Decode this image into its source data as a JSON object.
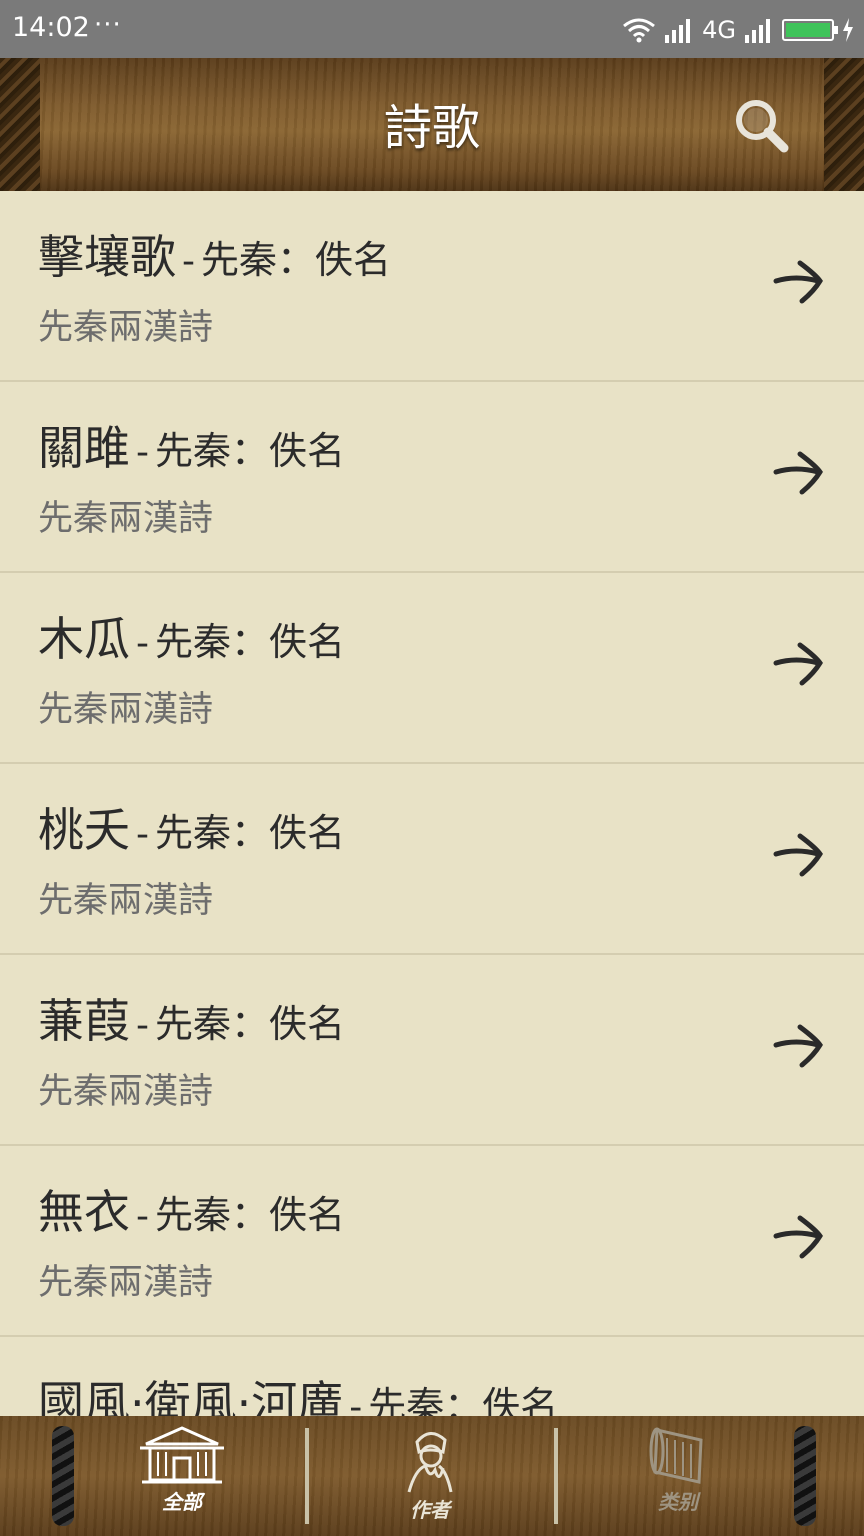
{
  "status_bar": {
    "time": "14:02",
    "dots": "···",
    "network": "4G"
  },
  "header": {
    "title": "詩歌"
  },
  "list": {
    "items": [
      {
        "title": "擊壤歌",
        "separator": "-",
        "author": "先秦：佚名",
        "category": "先秦兩漢詩"
      },
      {
        "title": "關雎",
        "separator": "-",
        "author": "先秦：佚名",
        "category": "先秦兩漢詩"
      },
      {
        "title": "木瓜",
        "separator": "-",
        "author": "先秦：佚名",
        "category": "先秦兩漢詩"
      },
      {
        "title": "桃夭",
        "separator": "-",
        "author": "先秦：佚名",
        "category": "先秦兩漢詩"
      },
      {
        "title": "蒹葭",
        "separator": "-",
        "author": "先秦：佚名",
        "category": "先秦兩漢詩"
      },
      {
        "title": "無衣",
        "separator": "-",
        "author": "先秦：佚名",
        "category": "先秦兩漢詩"
      },
      {
        "title": "國風·衛風·河廣",
        "separator": "-",
        "author": "先秦：佚名",
        "category": ""
      }
    ]
  },
  "tabs": [
    {
      "label": "全部",
      "icon": "house-icon",
      "active": true,
      "color": "#ffffff"
    },
    {
      "label": "作者",
      "icon": "poet-portrait-icon",
      "active": false,
      "color": "#e9e4d6"
    },
    {
      "label": "类别",
      "icon": "scroll-icon",
      "active": false,
      "color": "#9e9482"
    }
  ]
}
